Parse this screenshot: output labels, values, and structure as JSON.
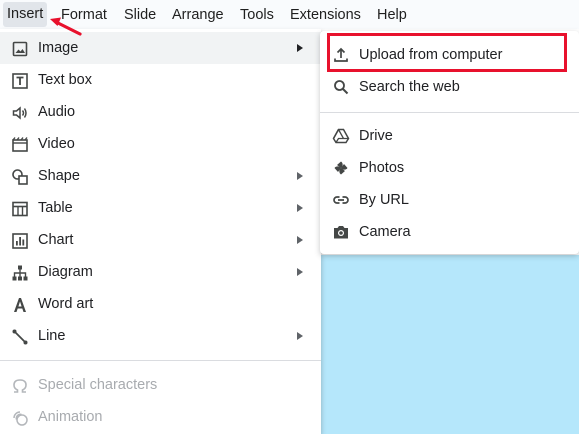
{
  "menubar": {
    "items": [
      "Insert",
      "Format",
      "Slide",
      "Arrange",
      "Tools",
      "Extensions",
      "Help"
    ]
  },
  "insert_menu": {
    "items": [
      {
        "label": "Image",
        "icon": "image-icon",
        "has_submenu": true
      },
      {
        "label": "Text box",
        "icon": "text-box-icon",
        "has_submenu": false
      },
      {
        "label": "Audio",
        "icon": "audio-icon",
        "has_submenu": false
      },
      {
        "label": "Video",
        "icon": "video-icon",
        "has_submenu": false
      },
      {
        "label": "Shape",
        "icon": "shape-icon",
        "has_submenu": true
      },
      {
        "label": "Table",
        "icon": "table-icon",
        "has_submenu": true
      },
      {
        "label": "Chart",
        "icon": "chart-icon",
        "has_submenu": true
      },
      {
        "label": "Diagram",
        "icon": "diagram-icon",
        "has_submenu": true
      },
      {
        "label": "Word art",
        "icon": "word-art-icon",
        "has_submenu": false
      },
      {
        "label": "Line",
        "icon": "line-icon",
        "has_submenu": true
      },
      {
        "label": "Special characters",
        "icon": "omega-icon",
        "disabled": true
      },
      {
        "label": "Animation",
        "icon": "animation-icon",
        "disabled": true
      }
    ]
  },
  "image_submenu": {
    "items": [
      {
        "label": "Upload from computer",
        "icon": "upload-icon"
      },
      {
        "label": "Search the web",
        "icon": "search-icon"
      },
      {
        "label": "Drive",
        "icon": "drive-icon"
      },
      {
        "label": "Photos",
        "icon": "photos-icon"
      },
      {
        "label": "By URL",
        "icon": "link-icon"
      },
      {
        "label": "Camera",
        "icon": "camera-icon"
      }
    ]
  },
  "colors": {
    "annotation_red": "#e8112d",
    "canvas_blue": "#b5e7fb",
    "hover_gray": "#f1f3f4"
  }
}
